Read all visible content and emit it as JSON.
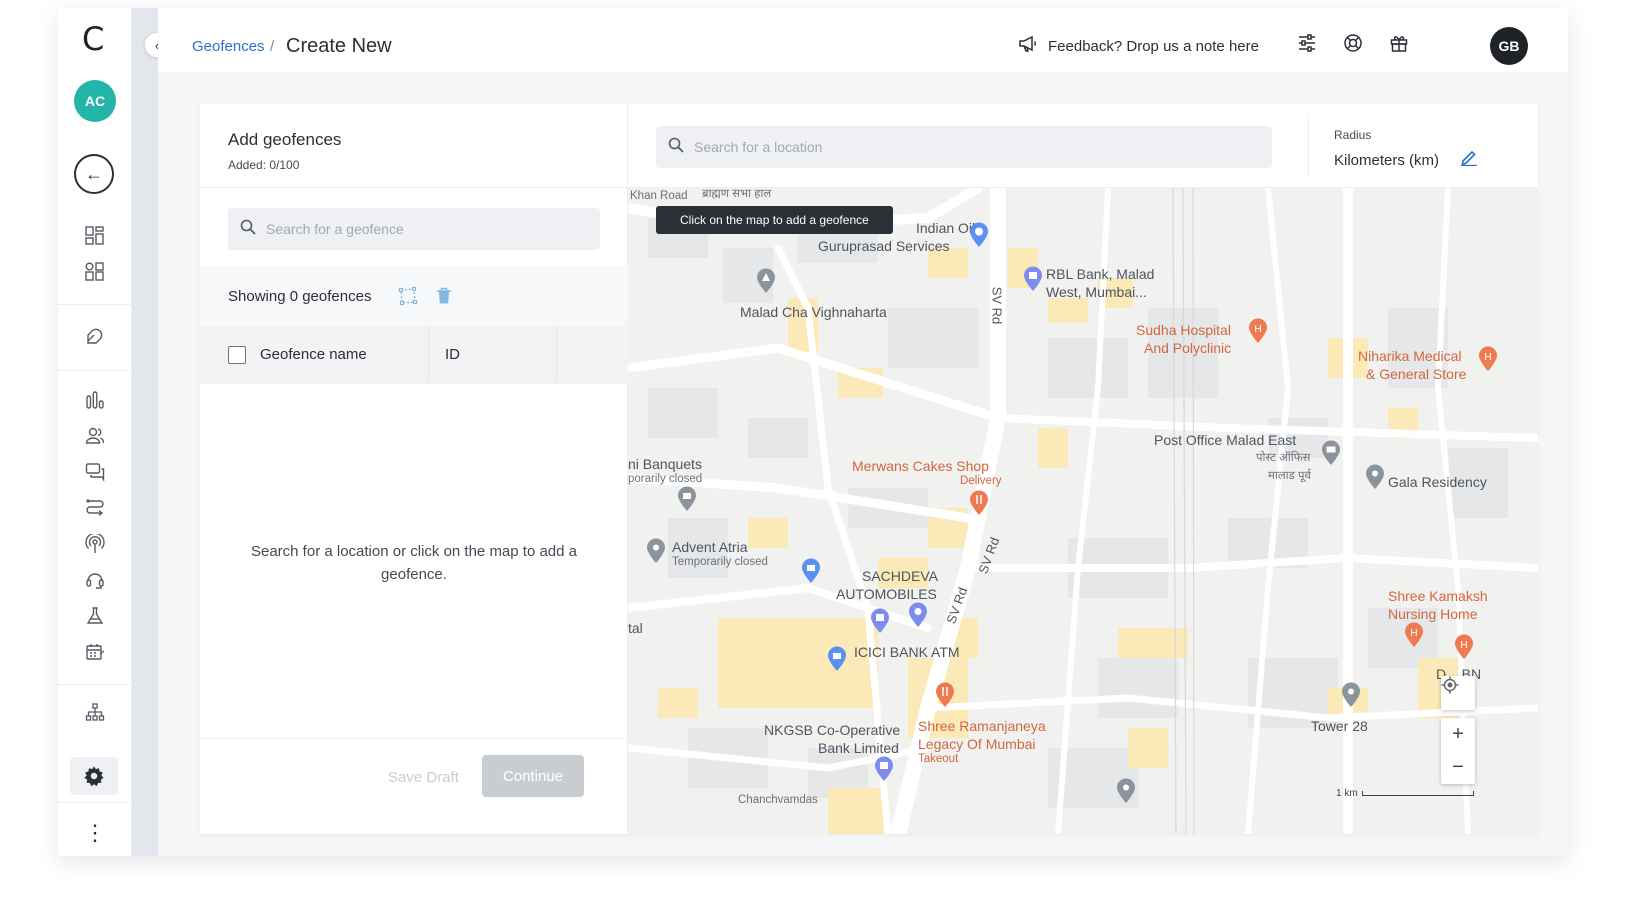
{
  "rail": {
    "logo": "C",
    "avatar": "AC",
    "icons": [
      "dashboard-icon",
      "apps-icon",
      "campaign-icon",
      "analytics-icon",
      "users-icon",
      "messages-icon",
      "journeys-icon",
      "broadcast-icon",
      "support-icon",
      "lab-icon",
      "calendar-icon",
      "hierarchy-icon",
      "settings-icon",
      "more-icon"
    ]
  },
  "header": {
    "breadcrumb_link": "Geofences",
    "breadcrumb_sep": "/",
    "title": "Create New",
    "feedback": "Feedback? Drop us a note here",
    "avatar": "GB"
  },
  "left_panel": {
    "title": "Add geofences",
    "added": "Added: 0/100",
    "search_placeholder": "Search for a geofence",
    "showing": "Showing 0 geofences",
    "columns": [
      "Geofence name",
      "ID"
    ],
    "empty_message": "Search for a location or click on the map to add a geofence.",
    "save_draft": "Save Draft",
    "continue": "Continue"
  },
  "map_panel": {
    "search_placeholder": "Search for a location",
    "radius_label": "Radius",
    "radius_value": "Kilometers (km)",
    "tooltip": "Click on the map to add a geofence",
    "scale": "1 km",
    "zoom_in": "+",
    "zoom_out": "−",
    "labels": {
      "indian_oil_1": "Indian Oil",
      "indian_oil_2": "Guruprasad Services",
      "rbl_1": "RBL Bank, Malad",
      "rbl_2": "West, Mumbai...",
      "malad_cha": "Malad Cha Vighnaharta",
      "sudha_1": "Sudha Hospital",
      "sudha_2": "And Polyclinic",
      "niharika_1": "Niharika Medical",
      "niharika_2": "& General Store",
      "post_office": "Post Office Malad East",
      "post_office_hi_1": "पोस्ट ऑफिस",
      "post_office_hi_2": "मालाड पूर्व",
      "gala": "Gala Residency",
      "banquets_1": "ni Banquets",
      "banquets_2": "porarily closed",
      "merwans_1": "Merwans Cakes Shop",
      "merwans_2": "Delivery",
      "advent_1": "Advent Atria",
      "advent_2": "Temporarily closed",
      "sachdeva_1": "SACHDEVA",
      "sachdeva_2": "AUTOMOBILES",
      "icici": "ICICI BANK ATM",
      "kamakshi_1": "Shree Kamaksh",
      "kamakshi_2": "Nursing Home",
      "nkgsb_1": "NKGSB Co-Operative",
      "nkgsb_2": "Bank Limited",
      "ramanjaneya_1": "Shree Ramanjaneya",
      "ramanjaneya_2": "Legacy Of Mumbai",
      "ramanjaneya_3": "Takeout",
      "tower": "Tower 28",
      "sv_rd_1": "SV Rd",
      "sv_rd_2": "SV Rd",
      "sv_rd_3": "SV Rd",
      "khan_road": "Khan Road",
      "hindi_top": "ब्राह्मण सभा हाल",
      "tal": "tal",
      "chanch": "Chanchvamdas",
      "dbn": "D... BN"
    }
  },
  "colors": {
    "accent": "#2a72c9",
    "avatar_teal": "#22b5a8",
    "map_bg": "#f1f1ef",
    "road": "#ffffff",
    "building": "#fbe9b7",
    "pin_blue": "#5b8ff0",
    "pin_orange": "#ee7a4f"
  }
}
